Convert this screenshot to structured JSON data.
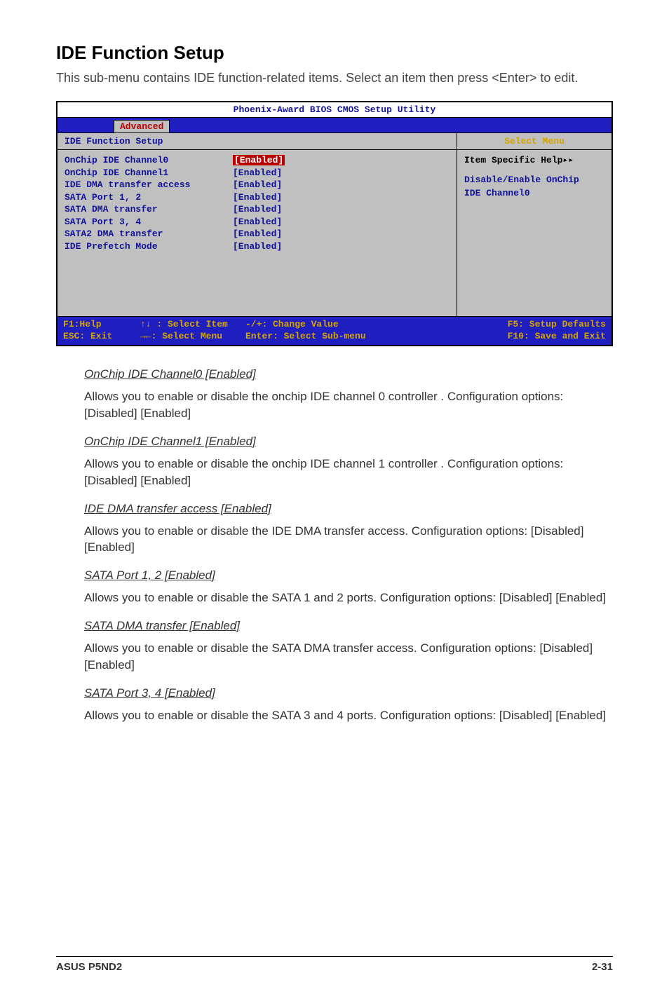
{
  "title": "IDE Function Setup",
  "intro": "This sub-menu contains IDE function-related items. Select an item then press <Enter> to edit.",
  "bios": {
    "title": "Phoenix-Award BIOS CMOS Setup Utility",
    "tab": "Advanced",
    "subheader": "IDE Function Setup",
    "right_header": "Select Menu",
    "items": [
      {
        "label": "OnChip IDE Channel0",
        "value": "[Enabled]",
        "selected": true
      },
      {
        "label": "OnChip IDE Channel1",
        "value": "[Enabled]"
      },
      {
        "label": "IDE DMA transfer access",
        "value": "[Enabled]"
      },
      {
        "label": "SATA Port 1, 2",
        "value": "[Enabled]"
      },
      {
        "label": "SATA DMA transfer",
        "value": "[Enabled]"
      },
      {
        "label": "SATA Port 3, 4",
        "value": "[Enabled]"
      },
      {
        "label": "SATA2 DMA transfer",
        "value": "[Enabled]"
      },
      {
        "label": "IDE Prefetch Mode",
        "value": "[Enabled]"
      }
    ],
    "help_title": "Item Specific Help▸▸",
    "help_body1": "Disable/Enable OnChip",
    "help_body2": "IDE Channel0",
    "footer": {
      "f1": "F1:Help",
      "select_item": "↑↓ : Select Item",
      "change": "-/+: Change Value",
      "f5": "F5: Setup Defaults",
      "esc": "ESC: Exit",
      "select_menu": "→←: Select Menu",
      "enter": "Enter: Select Sub-menu",
      "f10": "F10: Save and Exit"
    }
  },
  "sections": [
    {
      "head": "OnChip IDE Channel0 [Enabled]",
      "body": "Allows you to enable or disable the onchip IDE channel 0 controller . Configuration options: [Disabled] [Enabled]"
    },
    {
      "head": "OnChip IDE Channel1 [Enabled]",
      "body": "Allows you to enable or disable the onchip IDE channel 1 controller . Configuration options: [Disabled] [Enabled]"
    },
    {
      "head": "IDE DMA transfer access [Enabled]",
      "body": "Allows you to enable or disable the IDE DMA transfer access. Configuration options: [Disabled] [Enabled]"
    },
    {
      "head": "SATA Port 1, 2 [Enabled]",
      "body": "Allows you to enable or disable the SATA 1 and 2 ports. Configuration options: [Disabled] [Enabled]"
    },
    {
      "head": "SATA DMA transfer [Enabled]",
      "body": "Allows you to enable or disable the SATA DMA transfer access. Configuration options: [Disabled] [Enabled]"
    },
    {
      "head": "SATA Port 3, 4 [Enabled]",
      "body": "Allows you to enable or disable the SATA 3 and 4 ports. Configuration options: [Disabled] [Enabled]"
    }
  ],
  "footer_left": "ASUS P5ND2",
  "footer_right": "2-31"
}
